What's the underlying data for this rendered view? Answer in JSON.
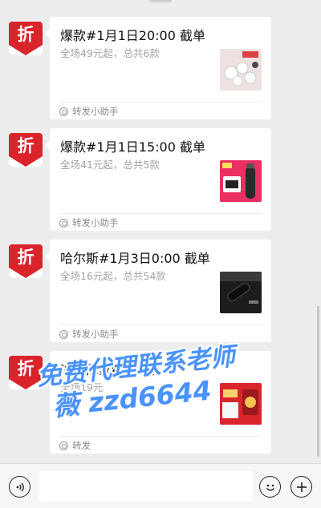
{
  "messages": [
    {
      "title": "爆款#1月1日20:00 截单",
      "subtitle": "全场49元起，总共6款",
      "footer": "转发小助手",
      "avatar_glyph": "折",
      "thumb_icon": "hair-accessory-photo"
    },
    {
      "title": "爆款#1月1日15:00 截单",
      "subtitle": "全场41元起，总共5款",
      "footer": "转发小助手",
      "avatar_glyph": "折",
      "thumb_icon": "thermos-product-photo"
    },
    {
      "title": "哈尔斯#1月3日0:00 截单",
      "subtitle": "全场16元起，总共54款",
      "footer": "转发小助手",
      "avatar_glyph": "折",
      "thumb_icon": "black-bottle-photo"
    },
    {
      "title": "迪士尼家纺#1月",
      "subtitle": "全场19元",
      "footer": "转发",
      "avatar_glyph": "折",
      "thumb_icon": "red-gift-box-photo"
    }
  ],
  "watermark": {
    "line1": "免费代理联系老师",
    "line2": "薇 zzd6644"
  },
  "colors": {
    "avatar_red": "#d9242b",
    "watermark_blue": "#4a93ff",
    "background": "#ededed"
  },
  "input_bar": {
    "voice_icon": "voice-icon",
    "emoji_icon": "emoji-icon",
    "plus_icon": "plus-icon"
  }
}
